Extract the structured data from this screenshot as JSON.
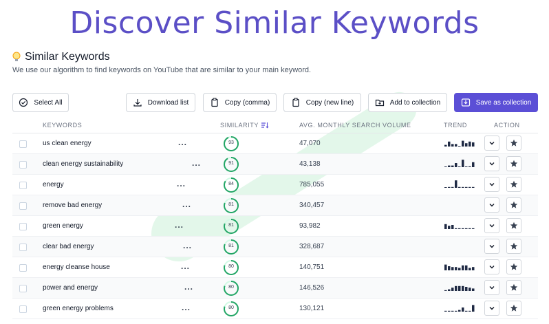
{
  "banner": {
    "title": "Discover Similar Keywords"
  },
  "section": {
    "title": "Similar Keywords",
    "description": "We use our algorithm to find keywords on YouTube that are similar to your main keyword."
  },
  "toolbar": {
    "select_all": "Select All",
    "download": "Download list",
    "copy_comma": "Copy (comma)",
    "copy_newline": "Copy (new line)",
    "add_collection": "Add to collection",
    "save_collection": "Save as collection"
  },
  "table": {
    "headers": {
      "keywords": "KEYWORDS",
      "similarity": "SIMILARITY",
      "volume": "AVG. MONTHLY SEARCH VOLUME",
      "trend": "TREND",
      "action": "ACTION"
    },
    "rows": [
      {
        "keyword": "us clean energy",
        "similarity": "93",
        "volume": "47,070",
        "trend": [
          0.2,
          0.6,
          0.3,
          0.3,
          0,
          0.7,
          0.4,
          0.6,
          0.5
        ]
      },
      {
        "keyword": "clean energy sustainability",
        "similarity": "91",
        "volume": "43,138",
        "trend": [
          0,
          0.2,
          0.2,
          0.5,
          0,
          0.9,
          0,
          0.1,
          0.6
        ]
      },
      {
        "keyword": "energy",
        "similarity": "84",
        "volume": "785,055",
        "trend": [
          0,
          0.1,
          0.1,
          0.9,
          0.1,
          0.1,
          0.1,
          0.1,
          0.1
        ]
      },
      {
        "keyword": "remove bad energy",
        "similarity": "81",
        "volume": "340,457",
        "trend": []
      },
      {
        "keyword": "green energy",
        "similarity": "81",
        "volume": "93,982",
        "trend": [
          0.6,
          0.4,
          0.5,
          0.1,
          0.1,
          0.1,
          0.1,
          0.1,
          0.1
        ]
      },
      {
        "keyword": "clear bad energy",
        "similarity": "81",
        "volume": "328,687",
        "trend": []
      },
      {
        "keyword": "energy cleanse house",
        "similarity": "80",
        "volume": "140,751",
        "trend": [
          0.7,
          0.5,
          0.4,
          0.4,
          0.3,
          0.6,
          0.6,
          0.3,
          0.4
        ]
      },
      {
        "keyword": "power and energy",
        "similarity": "80",
        "volume": "146,526",
        "trend": [
          0.1,
          0.2,
          0.4,
          0.6,
          0.6,
          0.6,
          0.5,
          0.4,
          0.3
        ]
      },
      {
        "keyword": "green energy problems",
        "similarity": "80",
        "volume": "130,121",
        "trend": [
          0.1,
          0.1,
          0.1,
          0.1,
          0.2,
          0.5,
          0.1,
          0.1,
          0.8
        ]
      }
    ]
  },
  "colors": {
    "accent": "#5b4fd6",
    "title": "#5b4fc6",
    "similarity_ring": "#22a565",
    "trend_bar": "#1f2a44"
  },
  "icons": [
    "lightbulb-icon",
    "check-circle-icon",
    "download-icon",
    "copy-icon",
    "folder-plus-icon",
    "save-icon",
    "sort-icon",
    "chevron-down-icon",
    "star-icon"
  ]
}
